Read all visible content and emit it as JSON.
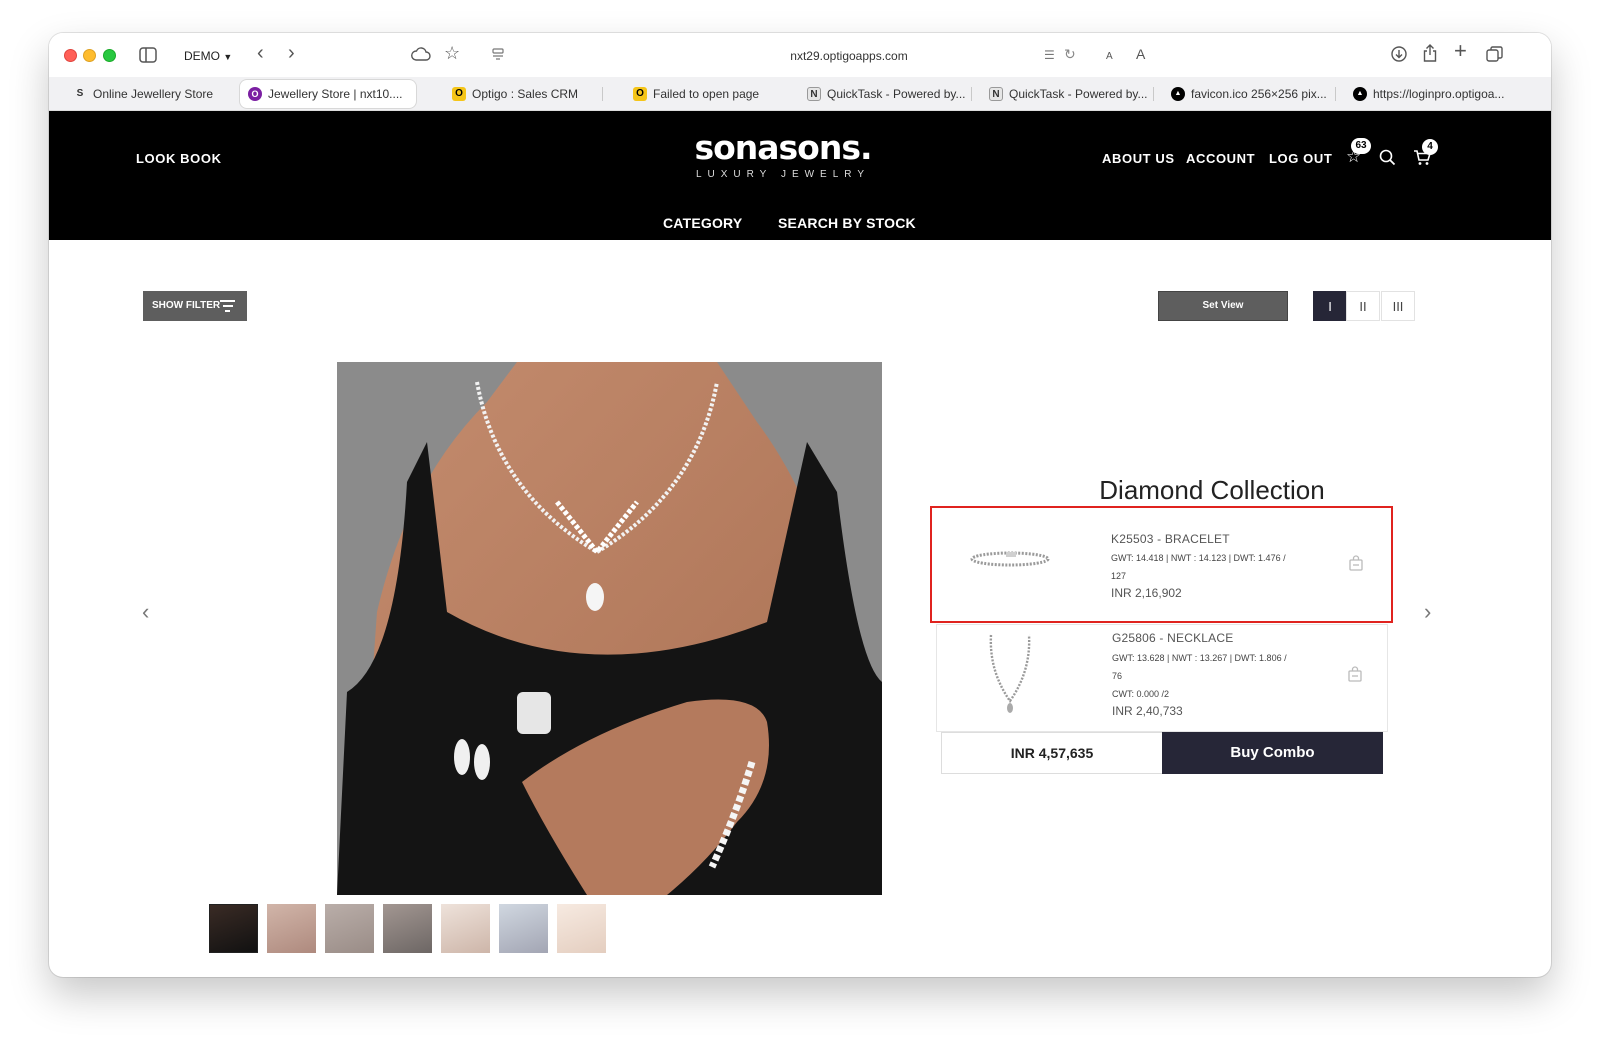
{
  "browser": {
    "profile": "DEMO",
    "address": "nxt29.optigoapps.com",
    "reader_small": "A",
    "reader_large": "A",
    "tabs": [
      {
        "label": "Online Jewellery Store",
        "favicon": "S"
      },
      {
        "label": "Jewellery Store | nxt10....",
        "favicon": "O"
      },
      {
        "label": "Optigo : Sales CRM",
        "favicon": "O"
      },
      {
        "label": "Failed to open page",
        "favicon": "O"
      },
      {
        "label": "QuickTask - Powered by...",
        "favicon": "N"
      },
      {
        "label": "QuickTask - Powered by...",
        "favicon": "N"
      },
      {
        "label": "favicon.ico 256×256 pix...",
        "favicon": "▲"
      },
      {
        "label": "https://loginpro.optigoa...",
        "favicon": "▲"
      }
    ]
  },
  "header": {
    "look_book": "LOOK BOOK",
    "logo_main": "sonasons.",
    "logo_sub": "LUXURY JEWELRY",
    "about_us": "ABOUT US",
    "account": "ACCOUNT",
    "log_out": "LOG OUT",
    "wishlist_count": "63",
    "cart_count": "4",
    "category": "CATEGORY",
    "search_by_stock": "SEARCH BY STOCK"
  },
  "controls": {
    "show_filter": "SHOW FILTER",
    "set_view": "Set View",
    "views": [
      "I",
      "II",
      "III"
    ],
    "selected_view": "I"
  },
  "collection": {
    "title": "Diamond Collection",
    "items": [
      {
        "title": "K25503 - BRACELET",
        "spec_line1": "GWT: 14.418 | NWT : 14.123 | DWT: 1.476 /",
        "spec_line2": "127",
        "price": "INR 2,16,902"
      },
      {
        "title": "G25806 - NECKLACE",
        "spec_line1": "GWT: 13.628 | NWT : 13.267 | DWT: 1.806 /",
        "spec_line2": "76",
        "spec_line3": "CWT: 0.000 /2",
        "price": "INR 2,40,733"
      }
    ],
    "total": "INR 4,57,635",
    "buy_combo": "Buy Combo"
  },
  "colors": {
    "header_bg": "#000000",
    "accent_dark": "#262637",
    "highlight_border": "#e0231f",
    "button_gray": "#5e5e5e"
  }
}
